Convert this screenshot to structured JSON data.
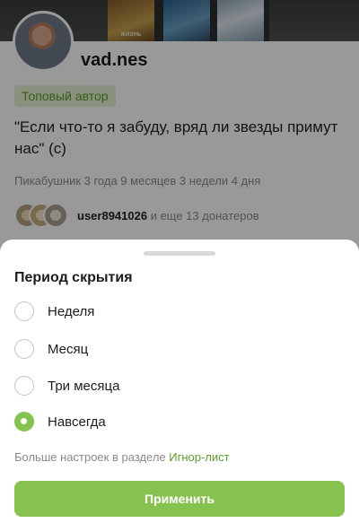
{
  "profile": {
    "books": [
      "ЖИЗНЬ",
      "",
      "",
      ""
    ],
    "username": "vad.nes",
    "badge": "Топовый автор",
    "quote": "\"Если что-то я забуду, вряд ли звезды примут нас\" (с)",
    "tenure": "Пикабушник 3 года 9 месяцев 3 недели 4 дня",
    "donors": {
      "name": "user8941026",
      "more": " и еще 13 донатеров"
    }
  },
  "sheet": {
    "title": "Период скрытия",
    "options": [
      {
        "label": "Неделя",
        "checked": false
      },
      {
        "label": "Месяц",
        "checked": false
      },
      {
        "label": "Три месяца",
        "checked": false
      },
      {
        "label": "Навсегда",
        "checked": true
      }
    ],
    "more_text": "Больше настроек в разделе ",
    "more_link": "Игнор-лист",
    "apply_label": "Применить"
  },
  "colors": {
    "accent": "#85c24f",
    "link": "#5c9b2c",
    "badge_bg": "#e3f3d2"
  }
}
